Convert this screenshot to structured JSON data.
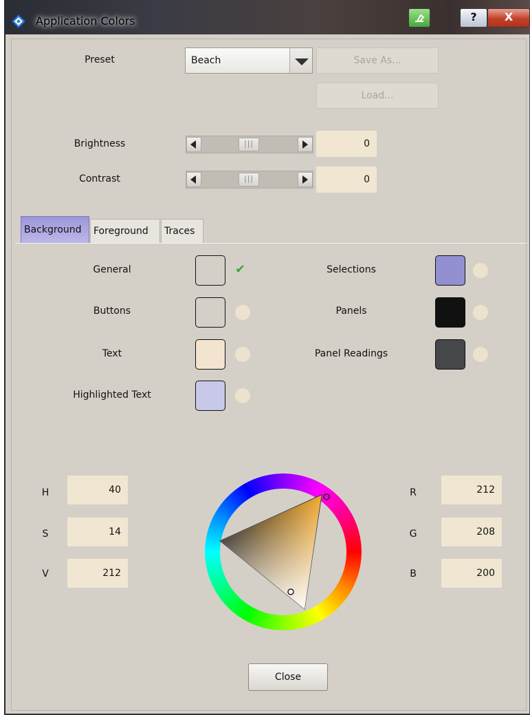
{
  "window": {
    "title": "Application Colors"
  },
  "titlebar": {
    "help_label": "?",
    "close_label": "X"
  },
  "preset": {
    "label": "Preset",
    "value": "Beach",
    "save_as_label": "Save As...",
    "load_label": "Load..."
  },
  "brightness": {
    "label": "Brightness",
    "value": "0"
  },
  "contrast": {
    "label": "Contrast",
    "value": "0"
  },
  "tabs": [
    {
      "label": "Background",
      "active": true
    },
    {
      "label": "Foreground",
      "active": false
    },
    {
      "label": "Traces",
      "active": false
    }
  ],
  "color_items_left": [
    {
      "label": "General",
      "color": "#d4d0c8",
      "checked": true
    },
    {
      "label": "Buttons",
      "color": "#d4d0c8",
      "checked": false
    },
    {
      "label": "Text",
      "color": "#f2e4cf",
      "checked": false
    },
    {
      "label": "Highlighted Text",
      "color": "#c8c8e8",
      "checked": false
    }
  ],
  "color_items_right": [
    {
      "label": "Selections",
      "color": "#9290d0",
      "checked": false
    },
    {
      "label": "Panels",
      "color": "#111111",
      "checked": false
    },
    {
      "label": "Panel Readings",
      "color": "#45474a",
      "checked": false
    }
  ],
  "hsv": {
    "h_label": "H",
    "h": "40",
    "s_label": "S",
    "s": "14",
    "v_label": "V",
    "v": "212"
  },
  "rgb": {
    "r_label": "R",
    "r": "212",
    "g_label": "G",
    "g": "208",
    "b_label": "B",
    "b": "200"
  },
  "close_label": "Close"
}
